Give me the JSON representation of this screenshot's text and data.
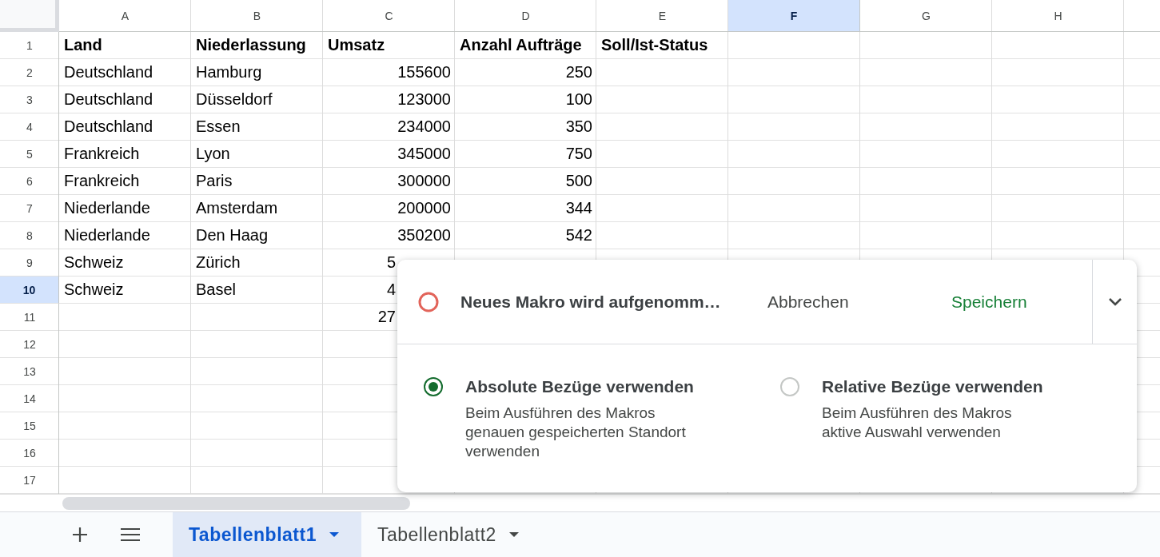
{
  "columns": [
    {
      "letter": "A",
      "selected": false,
      "kind": "text"
    },
    {
      "letter": "B",
      "selected": false,
      "kind": "text"
    },
    {
      "letter": "C",
      "selected": false,
      "kind": "number"
    },
    {
      "letter": "D",
      "selected": false,
      "kind": "number"
    },
    {
      "letter": "E",
      "selected": false
    },
    {
      "letter": "F",
      "selected": true
    },
    {
      "letter": "G",
      "selected": false
    },
    {
      "letter": "H",
      "selected": false
    }
  ],
  "rows": [
    {
      "number": "1",
      "selected": false,
      "kind": "header",
      "cells": [
        "Land",
        "Niederlassung",
        "Umsatz",
        "Anzahl Aufträge",
        "Soll/Ist-Status"
      ]
    },
    {
      "number": "2",
      "selected": false,
      "kind": "data",
      "cells": [
        "Deutschland",
        "Hamburg",
        "155600",
        "250"
      ]
    },
    {
      "number": "3",
      "selected": false,
      "kind": "data",
      "cells": [
        "Deutschland",
        "Düsseldorf",
        "123000",
        "100"
      ]
    },
    {
      "number": "4",
      "selected": false,
      "kind": "data",
      "cells": [
        "Deutschland",
        "Essen",
        "234000",
        "350"
      ]
    },
    {
      "number": "5",
      "selected": false,
      "kind": "data",
      "cells": [
        "Frankreich",
        "Lyon",
        "345000",
        "750"
      ]
    },
    {
      "number": "6",
      "selected": false,
      "kind": "data",
      "cells": [
        "Frankreich",
        "Paris",
        "300000",
        "500"
      ]
    },
    {
      "number": "7",
      "selected": false,
      "kind": "data",
      "cells": [
        "Niederlande",
        "Amsterdam",
        "200000",
        "344"
      ]
    },
    {
      "number": "8",
      "selected": false,
      "kind": "data",
      "cells": [
        "Niederlande",
        "Den Haag",
        "350200",
        "542"
      ]
    },
    {
      "number": "9",
      "selected": false,
      "kind": "data",
      "cells": [
        "Schweiz",
        "Zürich",
        "5"
      ]
    },
    {
      "number": "10",
      "selected": true,
      "kind": "data",
      "cells": [
        "Schweiz",
        "Basel",
        "4"
      ]
    },
    {
      "number": "11",
      "selected": false,
      "kind": "data",
      "cells": [
        null,
        null,
        "27"
      ]
    },
    {
      "number": "12",
      "selected": false
    },
    {
      "number": "13",
      "selected": false
    },
    {
      "number": "14",
      "selected": false
    },
    {
      "number": "15",
      "selected": false
    },
    {
      "number": "16",
      "selected": false
    },
    {
      "number": "17",
      "selected": false
    }
  ],
  "macro_recorder": {
    "status": "Neues Makro wird aufgenomm…",
    "cancel": "Abbrechen",
    "save": "Speichern",
    "expanded": true,
    "options": [
      {
        "label": "Absolute Bezüge verwenden",
        "description": "Beim Ausführen des Makros genauen gespeicherten Standort verwenden",
        "selected": true
      },
      {
        "label": "Relative Bezüge verwenden",
        "description": "Beim Ausführen des Makros aktive Auswahl verwenden",
        "selected": false
      }
    ]
  },
  "sheet_tabs": [
    {
      "label": "Tabellenblatt1",
      "selected": true
    },
    {
      "label": "Tabellenblatt2",
      "selected": false
    }
  ]
}
